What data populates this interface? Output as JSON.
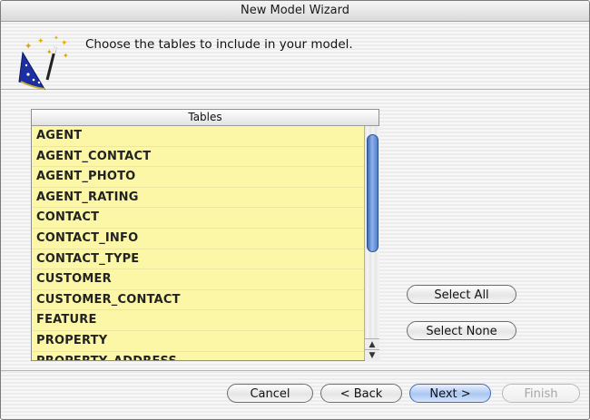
{
  "window": {
    "title": "New Model Wizard"
  },
  "header": {
    "instruction": "Choose the tables to include in your model."
  },
  "tables": {
    "header": "Tables",
    "rows": [
      "AGENT",
      "AGENT_CONTACT",
      "AGENT_PHOTO",
      "AGENT_RATING",
      "CONTACT",
      "CONTACT_INFO",
      "CONTACT_TYPE",
      "CUSTOMER",
      "CUSTOMER_CONTACT",
      "FEATURE",
      "PROPERTY",
      "PROPERTY_ADDRESS"
    ]
  },
  "selection_buttons": {
    "select_all": "Select All",
    "select_none": "Select None"
  },
  "nav_buttons": {
    "cancel": "Cancel",
    "back": "< Back",
    "next": "Next >",
    "finish": "Finish"
  },
  "colors": {
    "row_highlight": "#fbf7a7",
    "scroll_thumb": "#5a86d0"
  },
  "icons": {
    "wizard": "wizard-hat-wand-icon"
  }
}
